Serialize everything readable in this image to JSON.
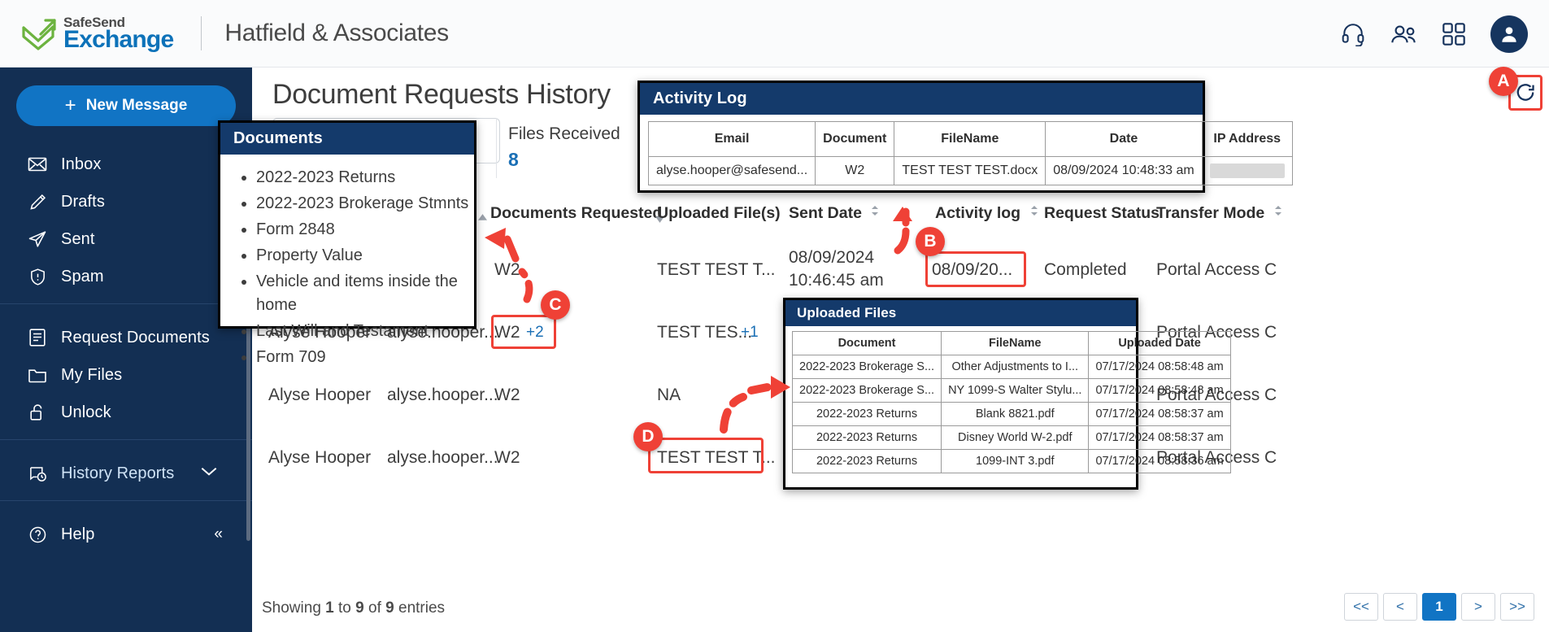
{
  "header": {
    "product_line1": "SafeSend",
    "product_line2": "Exchange",
    "company": "Hatfield & Associates",
    "icons": [
      "headset-icon",
      "contacts-icon",
      "apps-icon",
      "user-avatar-icon"
    ]
  },
  "sidebar": {
    "new_message_label": "New Message",
    "group1": [
      {
        "label": "Inbox",
        "icon": "envelope-icon"
      },
      {
        "label": "Drafts",
        "icon": "pencil-icon"
      },
      {
        "label": "Sent",
        "icon": "paper-plane-icon"
      },
      {
        "label": "Spam",
        "icon": "shield-alert-icon"
      }
    ],
    "group2": [
      {
        "label": "Request Documents",
        "icon": "document-request-icon"
      },
      {
        "label": "My Files",
        "icon": "folder-icon"
      },
      {
        "label": "Unlock",
        "icon": "unlock-icon"
      }
    ],
    "group3": [
      {
        "label": "History Reports",
        "icon": "history-report-icon",
        "chevron": "chevron-down-icon",
        "active": true
      }
    ],
    "group4": [
      {
        "label": "Help",
        "icon": "question-circle-icon",
        "collapse": "collapse-icon"
      }
    ]
  },
  "main": {
    "page_title": "Document Requests History",
    "stat": {
      "label": "Files Received",
      "value": "8"
    },
    "columns": [
      {
        "label": "Documents Requested"
      },
      {
        "label": "Uploaded File(s)"
      },
      {
        "label": "Sent Date"
      },
      {
        "label": "Activity log"
      },
      {
        "label": "Request Status"
      },
      {
        "label": "Transfer Mode"
      }
    ],
    "rows": [
      {
        "name": "",
        "email": "",
        "documents_requested": "W2",
        "plus": "",
        "uploaded_files": "TEST TEST T...",
        "sent_date_l1": "08/09/2024",
        "sent_date_l2": "10:46:45 am",
        "activity_log": "08/09/20...",
        "request_status": "Completed",
        "transfer_mode": "Portal Access C"
      },
      {
        "name": "Alyse Hooper",
        "email": "alyse.hooper...",
        "documents_requested": "W2",
        "plus": "+2",
        "uploaded_files": "TEST TES...",
        "uploaded_plus": "+1",
        "sent_date_l1": "",
        "sent_date_l2": "",
        "activity_log": "",
        "request_status": "",
        "transfer_mode": "Portal Access C"
      },
      {
        "name": "Alyse Hooper",
        "email": "alyse.hooper...",
        "documents_requested": "W2",
        "plus": "",
        "uploaded_files": "NA",
        "sent_date_l1": "",
        "sent_date_l2": "",
        "activity_log": "",
        "request_status": "",
        "transfer_mode": "Portal Access C"
      },
      {
        "name": "Alyse Hooper",
        "email": "alyse.hooper...",
        "documents_requested": "W2",
        "plus": "",
        "uploaded_files": "TEST TEST T...",
        "sent_date_l1": "",
        "sent_date_l2": "",
        "activity_log": "",
        "request_status": "",
        "transfer_mode": "Portal Access C"
      }
    ],
    "showing_prefix": "Showing ",
    "showing_from": "1",
    "showing_mid": " to ",
    "showing_to": "9",
    "showing_mid2": " of ",
    "showing_total": "9",
    "showing_suffix": " entries",
    "pager": [
      "<<",
      "<",
      "1",
      ">",
      ">>"
    ],
    "pager_current": "1"
  },
  "documents_popup": {
    "title": "Documents",
    "items": [
      "2022-2023 Returns",
      "2022-2023 Brokerage Stmnts",
      "Form 2848",
      "Property Value",
      "Vehicle and items inside the home",
      "Last Will and Testament",
      "Form 709"
    ]
  },
  "activity_log_popup": {
    "title": "Activity Log",
    "columns": [
      "Email",
      "Document",
      "FileName",
      "Date",
      "IP Address"
    ],
    "rows": [
      {
        "email": "alyse.hooper@safesend...",
        "document": "W2",
        "filename": "TEST TEST TEST.docx",
        "date": "08/09/2024 10:48:33 am",
        "ip": ""
      }
    ]
  },
  "uploaded_files_popup": {
    "title": "Uploaded Files",
    "columns": [
      "Document",
      "FileName",
      "Uploaded Date"
    ],
    "rows": [
      {
        "document": "2022-2023 Brokerage S...",
        "filename": "Other Adjustments to I...",
        "uploaded": "07/17/2024 08:58:48 am"
      },
      {
        "document": "2022-2023 Brokerage S...",
        "filename": "NY 1099-S Walter Stylu...",
        "uploaded": "07/17/2024 08:58:48 am"
      },
      {
        "document": "2022-2023 Returns",
        "filename": "Blank 8821.pdf",
        "uploaded": "07/17/2024 08:58:37 am"
      },
      {
        "document": "2022-2023 Returns",
        "filename": "Disney World W-2.pdf",
        "uploaded": "07/17/2024 08:58:37 am"
      },
      {
        "document": "2022-2023 Returns",
        "filename": "1099-INT 3.pdf",
        "uploaded": "07/17/2024 08:58:36 am"
      }
    ]
  },
  "annotations": {
    "a": "A",
    "b": "B",
    "c": "C",
    "d": "D"
  },
  "colors": {
    "brand_navy": "#132f53",
    "brand_blue": "#1174c4",
    "panel_header": "#143a6b",
    "annotation_red": "#ef4136",
    "logo_green": "#6cb33f"
  }
}
